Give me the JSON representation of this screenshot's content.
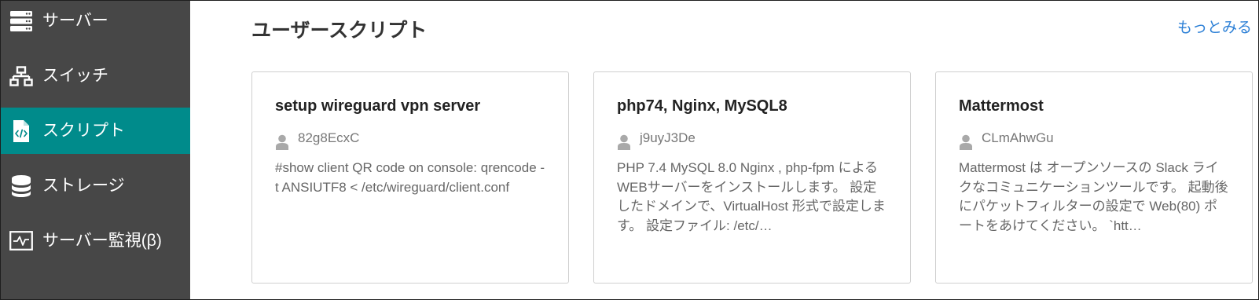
{
  "colors": {
    "sidebar_bg": "#474747",
    "active_bg": "#008b8b",
    "link": "#2b7fd6",
    "card_border": "#cfcfcf"
  },
  "sidebar": {
    "items": [
      {
        "label": "サーバー",
        "icon": "server-icon",
        "active": false
      },
      {
        "label": "スイッチ",
        "icon": "network-icon",
        "active": false
      },
      {
        "label": "スクリプト",
        "icon": "file-code-icon",
        "active": true
      },
      {
        "label": "ストレージ",
        "icon": "database-icon",
        "active": false
      },
      {
        "label": "サーバー監視(β)",
        "icon": "monitor-icon",
        "active": false
      }
    ]
  },
  "section": {
    "title": "ユーザースクリプト",
    "more_link": "もっとみる"
  },
  "cards": [
    {
      "title": "setup wireguard vpn server",
      "author": "82g8EcxC",
      "description": "#show client QR code on console: qrencode -t ANSIUTF8 < /etc/wireguard/client.conf"
    },
    {
      "title": "php74, Nginx, MySQL8",
      "author": "j9uyJ3De",
      "description": "PHP 7.4 MySQL 8.0 Nginx , php-fpm によるWEBサーバーをインストールします。 設定したドメインで、VirtualHost 形式で設定します。 設定ファイル: /etc/…"
    },
    {
      "title": "Mattermost",
      "author": "CLmAhwGu",
      "description": "Mattermost は オープンソースの Slack ライクなコミュニケーションツールです。 起動後にパケットフィルターの設定で Web(80) ポートをあけてください。 `htt…"
    }
  ]
}
